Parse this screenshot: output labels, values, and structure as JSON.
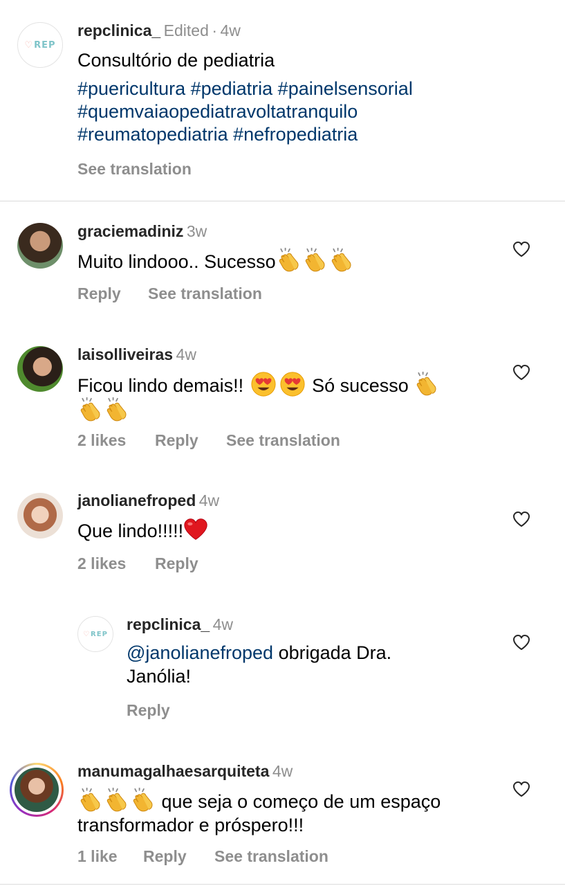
{
  "caption": {
    "username": "repclinica_",
    "edited": "Edited",
    "time": "4w",
    "avatar_logo": "REP",
    "text": "Consultório de pediatria",
    "hashtag_lines": [
      "#puericultura #pediatria #painelsensorial",
      "#quemvaiaopediatravoltatranquilo",
      "#reumatopediatria #nefropediatria"
    ],
    "see_translation": "See translation"
  },
  "comments": [
    {
      "username": "graciemadiniz",
      "time": "3w",
      "text": "Muito lindooo.. Sucesso",
      "emoji_suffix": "clapping-hands x3",
      "reply": "Reply",
      "see_translation": "See translation",
      "avatar_color": "#5a4a3a"
    },
    {
      "username": "laisolliveiras",
      "time": "4w",
      "text_before": "Ficou lindo demais!!",
      "text_after": "Só sucesso",
      "emoji": "heart-eyes x2, clapping-hands x3",
      "likes": "2 likes",
      "reply": "Reply",
      "see_translation": "See translation",
      "avatar_color": "#3d6b2a"
    },
    {
      "username": "janolianefroped",
      "time": "4w",
      "text": "Que lindo!!!!!",
      "emoji": "red-heart",
      "likes": "2 likes",
      "reply": "Reply",
      "avatar_color": "#e8d8cc"
    }
  ],
  "nested_reply": {
    "username": "repclinica_",
    "time": "4w",
    "avatar_logo": "REP",
    "mention": "@janolianefroped",
    "text_line1": " obrigada Dra.",
    "text_line2": "Janólia!",
    "reply": "Reply"
  },
  "last_comment": {
    "username": "manumagalhaesarquiteta",
    "time": "4w",
    "emoji": "clapping-hands x3",
    "text_line1": "que seja o começo de um espaço",
    "text_line2": "transformador e próspero!!!",
    "likes": "1 like",
    "reply": "Reply",
    "see_translation": "See translation",
    "story_ring": true,
    "avatar_color": "#2f5a45"
  },
  "colors": {
    "username": "#262626",
    "secondary": "#8e8e8e",
    "hashtag": "#00376b",
    "divider": "#dbdbdb",
    "logo": "#7fc4c9"
  }
}
